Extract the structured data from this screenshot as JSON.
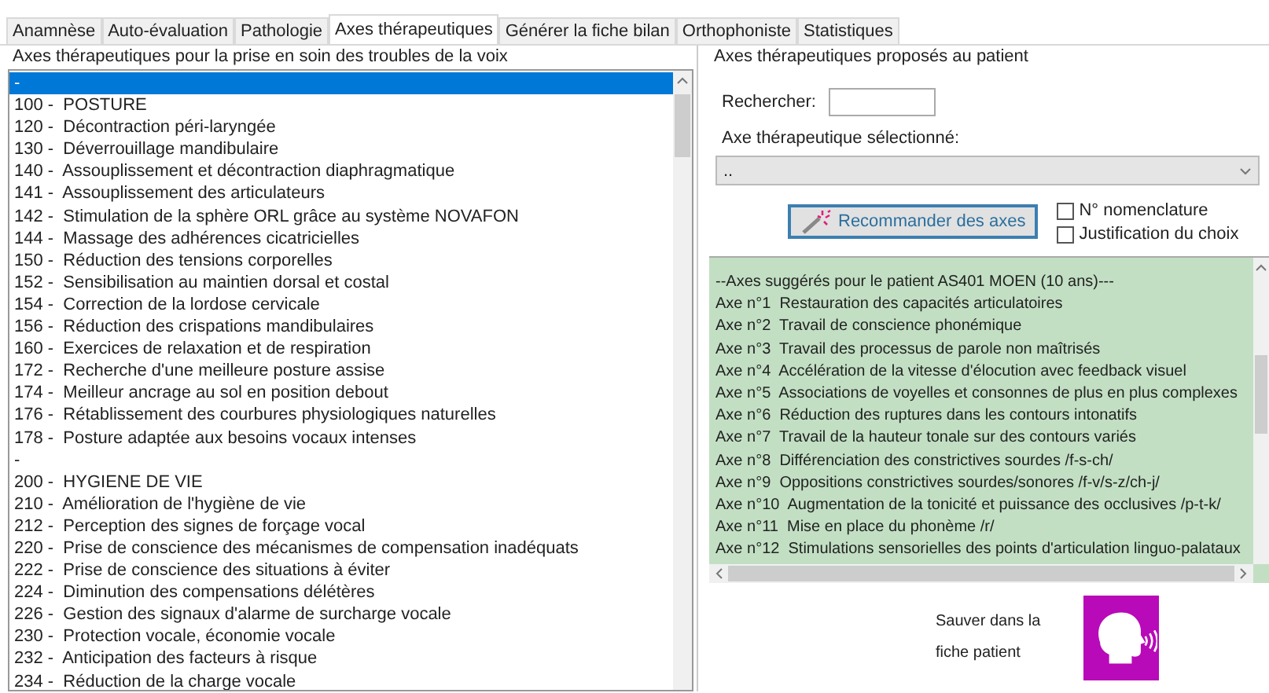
{
  "tabs": [
    {
      "label": "Anamnèse",
      "selected": false
    },
    {
      "label": "Auto-évaluation",
      "selected": false
    },
    {
      "label": "Pathologie",
      "selected": false
    },
    {
      "label": "Axes thérapeutiques",
      "selected": true
    },
    {
      "label": "Générer la fiche bilan",
      "selected": false
    },
    {
      "label": "Orthophoniste",
      "selected": false
    },
    {
      "label": "Statistiques",
      "selected": false
    }
  ],
  "axes_list": {
    "title": "Axes thérapeutiques pour la prise en soin des troubles de la voix",
    "items": [
      {
        "label": "-",
        "selected": true
      },
      {
        "label": "100 -  POSTURE",
        "selected": false
      },
      {
        "label": "120 -  Décontraction péri-laryngée",
        "selected": false
      },
      {
        "label": "130 -  Déverrouillage mandibulaire",
        "selected": false
      },
      {
        "label": "140 -  Assouplissement et décontraction diaphragmatique",
        "selected": false
      },
      {
        "label": "141 -  Assouplissement des articulateurs",
        "selected": false
      },
      {
        "label": "142 -  Stimulation de la sphère ORL grâce au système NOVAFON",
        "selected": false
      },
      {
        "label": "144 -  Massage des adhérences cicatricielles",
        "selected": false
      },
      {
        "label": "150 -  Réduction des tensions corporelles",
        "selected": false
      },
      {
        "label": "152 -  Sensibilisation au maintien dorsal et costal",
        "selected": false
      },
      {
        "label": "154 -  Correction de la lordose cervicale",
        "selected": false
      },
      {
        "label": "156 -  Réduction des crispations mandibulaires",
        "selected": false
      },
      {
        "label": "160 -  Exercices de relaxation et de respiration",
        "selected": false
      },
      {
        "label": "172 -  Recherche d'une meilleure posture assise",
        "selected": false
      },
      {
        "label": "174 -  Meilleur ancrage au sol en position debout",
        "selected": false
      },
      {
        "label": "176 -  Rétablissement des courbures physiologiques naturelles",
        "selected": false
      },
      {
        "label": "178 -  Posture adaptée aux besoins vocaux intenses",
        "selected": false
      },
      {
        "label": "-",
        "selected": false
      },
      {
        "label": "200 -  HYGIENE DE VIE",
        "selected": false
      },
      {
        "label": "210 -  Amélioration de l'hygiène de vie",
        "selected": false
      },
      {
        "label": "212 -  Perception des signes de forçage vocal",
        "selected": false
      },
      {
        "label": "220 -  Prise de conscience des mécanismes de compensation inadéquats",
        "selected": false
      },
      {
        "label": "222 -  Prise de conscience des situations à éviter",
        "selected": false
      },
      {
        "label": "224 -  Diminution des compensations délétères",
        "selected": false
      },
      {
        "label": "226 -  Gestion des signaux d'alarme de surcharge vocale",
        "selected": false
      },
      {
        "label": "230 -  Protection vocale, économie vocale",
        "selected": false
      },
      {
        "label": "232 -  Anticipation des facteurs à risque",
        "selected": false
      },
      {
        "label": "234 -  Réduction de la charge vocale",
        "selected": false
      }
    ]
  },
  "proposed": {
    "title": "Axes thérapeutiques proposés au patient",
    "search_label": "Rechercher:",
    "selected_label": "Axe thérapeutique sélectionné:",
    "selected_value": "..",
    "recommend_button": "Recommander des axes",
    "options": [
      {
        "label": "N° nomenclature",
        "checked": false
      },
      {
        "label": "Justification du choix",
        "checked": false
      }
    ],
    "suggestions": [
      "--Axes suggérés pour le patient AS401 MOEN (10 ans)---",
      "Axe n°1  Restauration des capacités articulatoires",
      "Axe n°2  Travail de conscience phonémique",
      "Axe n°3  Travail des processus de parole non maîtrisés",
      "Axe n°4  Accélération de la vitesse d'élocution avec feedback visuel",
      "Axe n°5  Associations de voyelles et consonnes de plus en plus complexes",
      "Axe n°6  Réduction des ruptures dans les contours intonatifs",
      "Axe n°7  Travail de la hauteur tonale sur des contours variés",
      "Axe n°8  Différenciation des constrictives sourdes /f-s-ch/",
      "Axe n°9  Oppositions constrictives sourdes/sonores /f-v/s-z/ch-j/",
      "Axe n°10  Augmentation de la tonicité et puissance des occlusives /p-t-k/",
      "Axe n°11  Mise en place du phonème /r/",
      "Axe n°12  Stimulations sensorielles des points d'articulation linguo-palataux"
    ],
    "save_label": "Sauver dans la fiche patient"
  }
}
